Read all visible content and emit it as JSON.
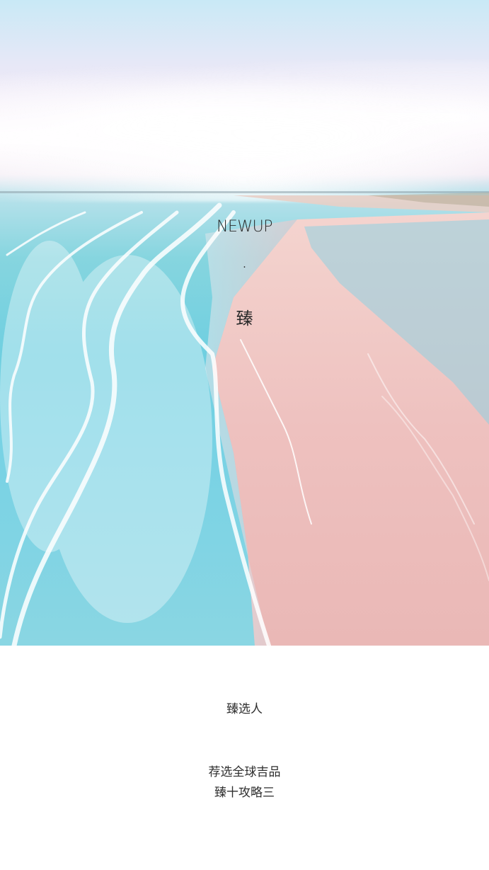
{
  "hero": {
    "brand": "NEWUP",
    "dot": "·",
    "char": "臻"
  },
  "footer": {
    "title": "臻选人",
    "line1": "荐选全球吉品",
    "line2": "臻十攻略三"
  },
  "colors": {
    "sea": "#78d2e4",
    "sand": "#eec1bf",
    "sky": "#e7e8f7",
    "text": "#2b2b2b"
  }
}
